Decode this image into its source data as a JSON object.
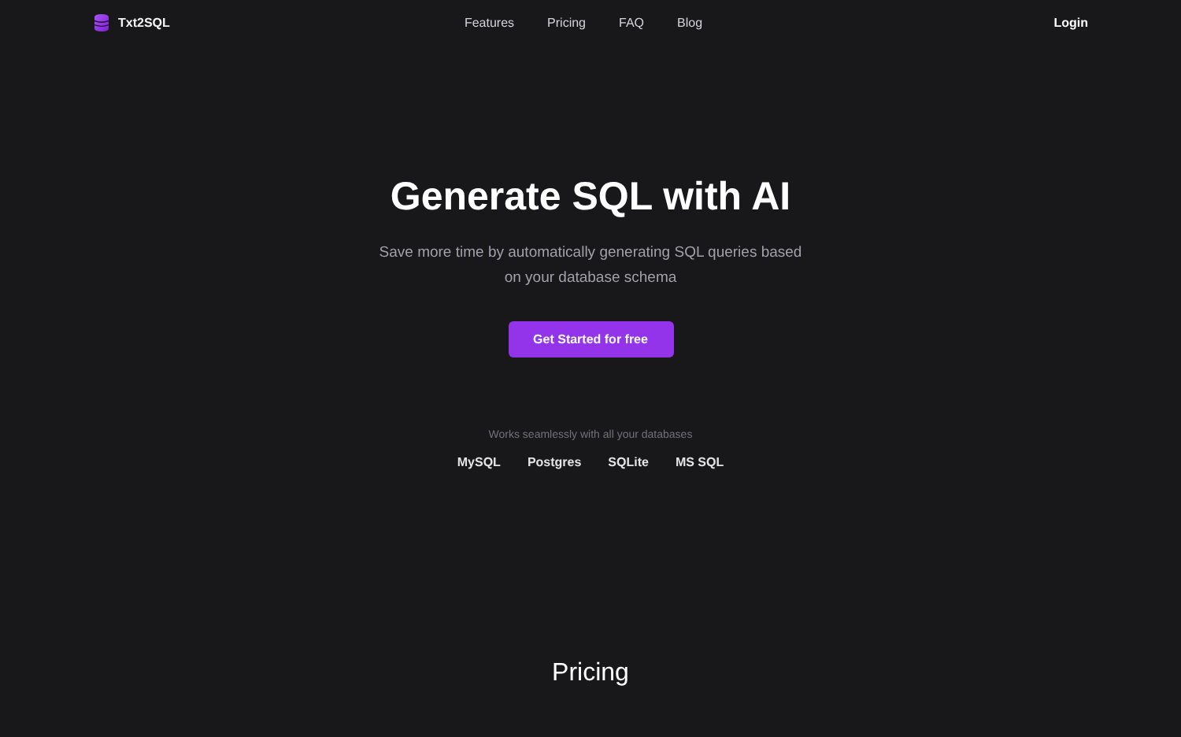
{
  "brand": {
    "name": "Txt2SQL"
  },
  "nav": {
    "links": [
      "Features",
      "Pricing",
      "FAQ",
      "Blog"
    ],
    "login": "Login"
  },
  "hero": {
    "title": "Generate SQL with AI",
    "subtitle": "Save more time by automatically generating SQL queries based on your database schema",
    "cta": "Get Started for free"
  },
  "databases": {
    "caption": "Works seamlessly with all your databases",
    "items": [
      "MySQL",
      "Postgres",
      "SQLite",
      "MS SQL"
    ]
  },
  "pricing": {
    "heading": "Pricing"
  }
}
